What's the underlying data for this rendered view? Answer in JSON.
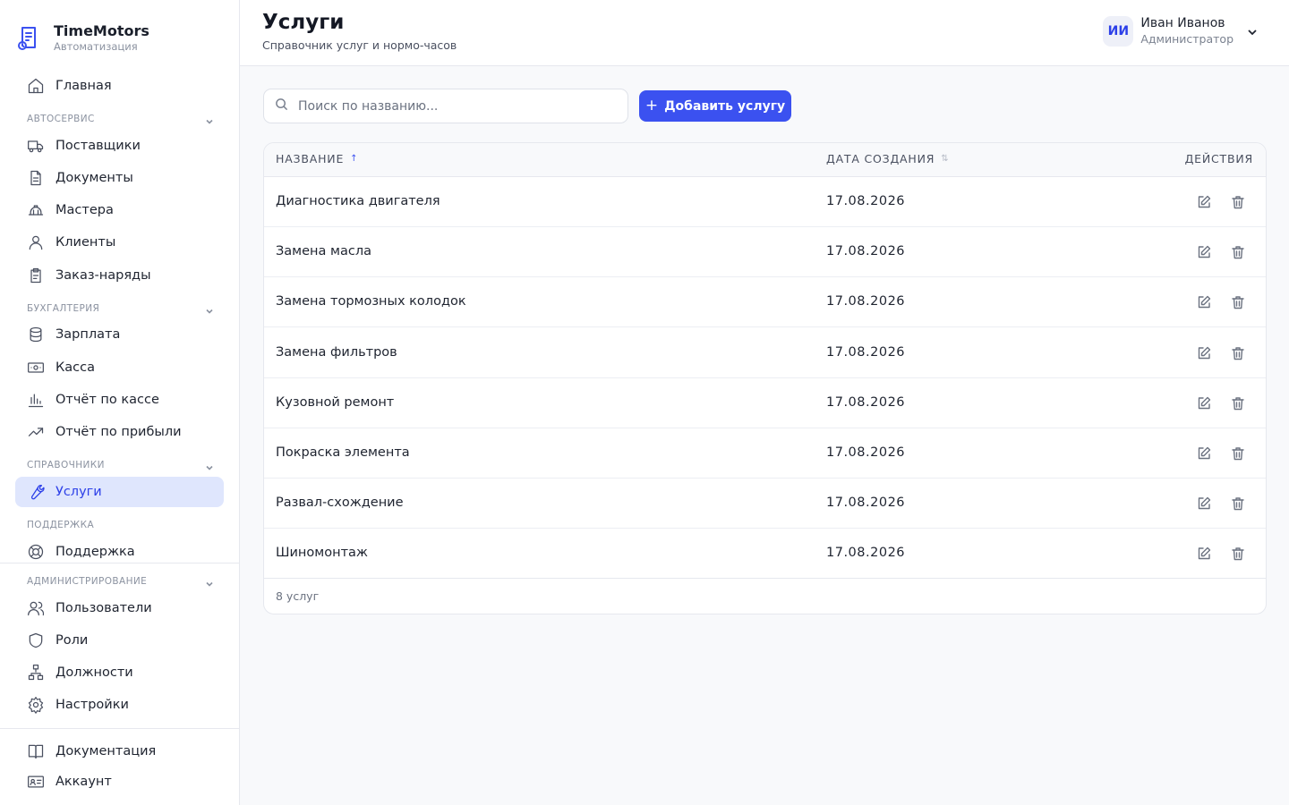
{
  "brand": {
    "name": "TimeMotors",
    "subtitle": "Автоматизация"
  },
  "nav": {
    "home": "Главная",
    "sections": {
      "autoservice": "АВТОСЕРВИС",
      "accounting": "БУХГАЛТЕРИЯ",
      "references": "СПРАВОЧНИКИ",
      "support": "ПОДДЕРЖКА",
      "admin": "АДМИНИСТРИРОВАНИЕ"
    },
    "suppliers": "Поставщики",
    "documents": "Документы",
    "masters": "Мастера",
    "clients": "Клиенты",
    "orders": "Заказ-наряды",
    "salary": "Зарплата",
    "cashbox": "Касса",
    "cash_report": "Отчёт по кассе",
    "profit_report": "Отчёт по прибыли",
    "services": "Услуги",
    "support_item": "Поддержка",
    "users": "Пользователи",
    "roles": "Роли",
    "positions": "Должности",
    "settings": "Настройки",
    "docs": "Документация",
    "account": "Аккаунт"
  },
  "header": {
    "title": "Услуги",
    "subtitle": "Справочник услуг и нормо-часов",
    "user": {
      "initials": "ИИ",
      "name": "Иван Иванов",
      "role": "Администратор"
    }
  },
  "toolbar": {
    "search_placeholder": "Поиск по названию...",
    "add_label": "Добавить услугу",
    "add_symbol": "+"
  },
  "table": {
    "columns": {
      "name": "НАЗВАНИЕ",
      "date": "ДАТА СОЗДАНИЯ",
      "actions": "ДЕЙСТВИЯ"
    },
    "sort_up": "↑",
    "sort_both": "⇅",
    "rows": [
      {
        "name": "Диагностика двигателя",
        "date": "17.08.2026"
      },
      {
        "name": "Замена масла",
        "date": "17.08.2026"
      },
      {
        "name": "Замена тормозных колодок",
        "date": "17.08.2026"
      },
      {
        "name": "Замена фильтров",
        "date": "17.08.2026"
      },
      {
        "name": "Кузовной ремонт",
        "date": "17.08.2026"
      },
      {
        "name": "Покраска элемента",
        "date": "17.08.2026"
      },
      {
        "name": "Развал-схождение",
        "date": "17.08.2026"
      },
      {
        "name": "Шиномонтаж",
        "date": "17.08.2026"
      }
    ],
    "count_label": "8 услуг"
  },
  "colors": {
    "accent": "#3b51f0",
    "active_bg": "#dfe6fd",
    "border": "#e6e8ee"
  }
}
